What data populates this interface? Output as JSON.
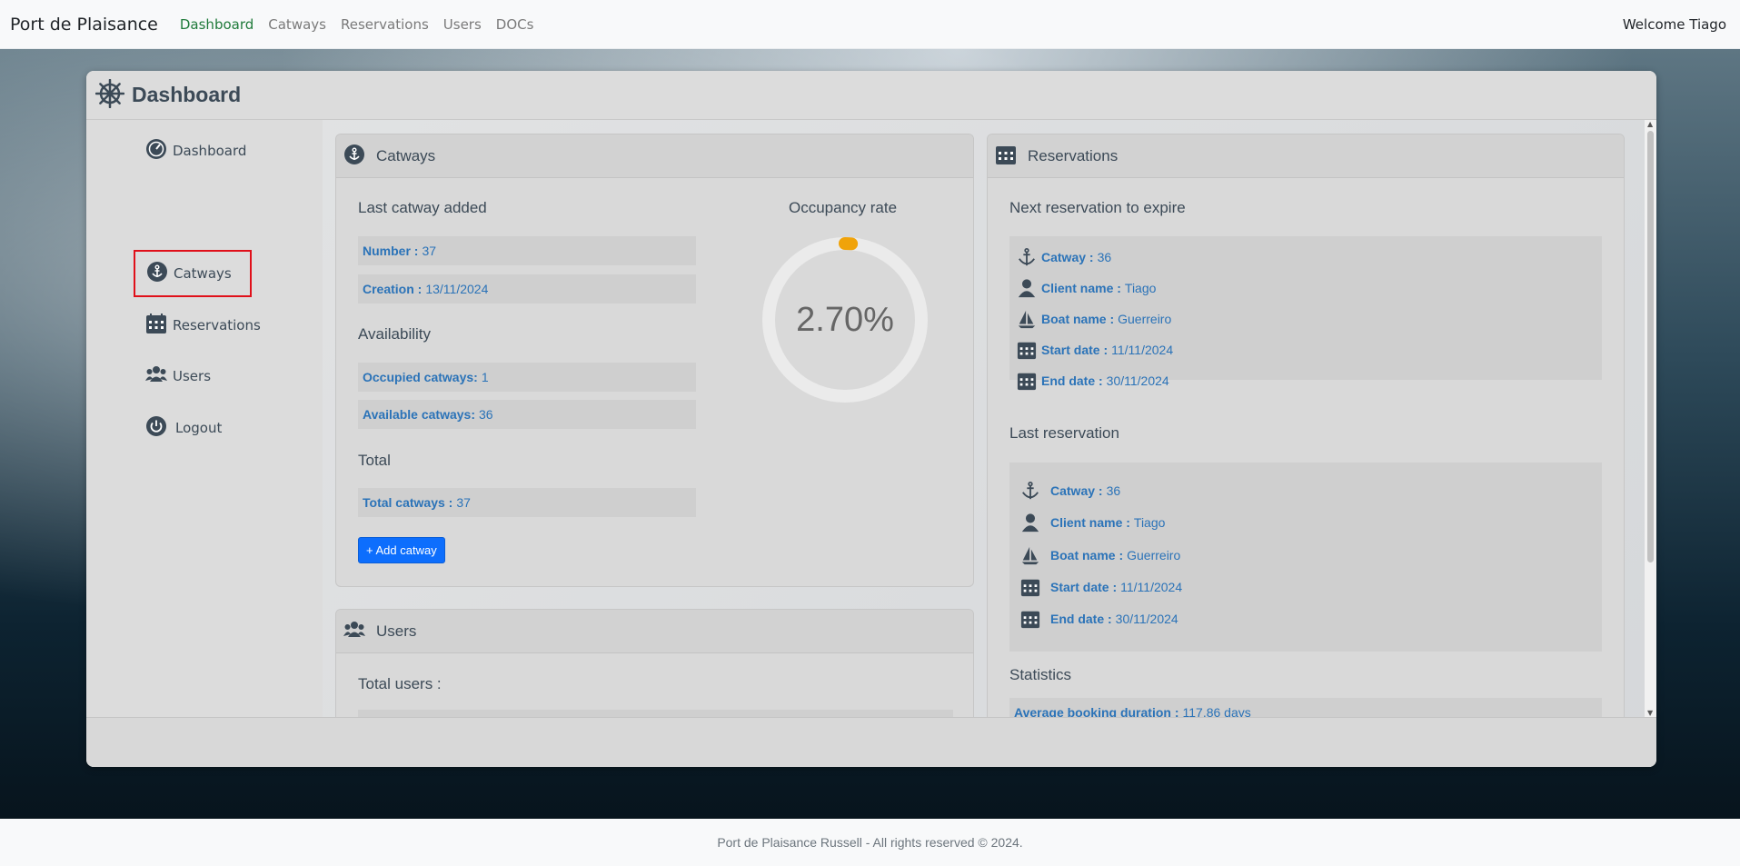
{
  "navbar": {
    "brand": "Port de Plaisance",
    "links": [
      "Dashboard",
      "Catways",
      "Reservations",
      "Users",
      "DOCs"
    ],
    "welcome": "Welcome Tiago"
  },
  "window": {
    "title": "Dashboard"
  },
  "sidebar": {
    "items": [
      {
        "label": "Dashboard",
        "icon": "dashboard-gauge-icon"
      },
      {
        "label": "Catways",
        "icon": "anchor-icon"
      },
      {
        "label": "Reservations",
        "icon": "calendar-icon"
      },
      {
        "label": "Users",
        "icon": "users-icon"
      },
      {
        "label": "Logout",
        "icon": "power-icon"
      }
    ]
  },
  "catways_card": {
    "title": "Catways",
    "last_added_heading": "Last catway added",
    "number_label": "Number :",
    "number_value": "37",
    "creation_label": "Creation :",
    "creation_value": "13/11/2024",
    "availability_heading": "Availability",
    "occupied_label": "Occupied catways:",
    "occupied_value": "1",
    "available_label": "Available catways:",
    "available_value": "36",
    "total_heading": "Total",
    "total_label": "Total catways :",
    "total_value": "37",
    "add_button": "+ Add catway",
    "occupancy_heading": "Occupancy rate",
    "occupancy_text": "2.70%",
    "occupancy_fraction": 0.027,
    "colors": {
      "gauge_fill": "#f0a30a",
      "gauge_track": "#ebebeb"
    }
  },
  "users_card": {
    "title": "Users",
    "total_users_label": "Total users :"
  },
  "reservations_card": {
    "title": "Reservations",
    "next_heading": "Next reservation to expire",
    "next": {
      "catway_label": "Catway :",
      "catway_value": "36",
      "client_label": "Client name :",
      "client_value": "Tiago",
      "boat_label": "Boat name :",
      "boat_value": "Guerreiro",
      "start_label": "Start date :",
      "start_value": "11/11/2024",
      "end_label": "End date :",
      "end_value": "30/11/2024"
    },
    "last_heading": "Last reservation",
    "last": {
      "catway_label": "Catway :",
      "catway_value": "36",
      "client_label": "Client name :",
      "client_value": "Tiago",
      "boat_label": "Boat name :",
      "boat_value": "Guerreiro",
      "start_label": "Start date :",
      "start_value": "11/11/2024",
      "end_label": "End date :",
      "end_value": "30/11/2024"
    },
    "statistics_heading": "Statistics",
    "avg_label": "Average booking duration :",
    "avg_value": "117.86 days"
  },
  "footer": {
    "text": "Port de Plaisance Russell - All rights reserved © 2024."
  },
  "colors": {
    "accent_link": "#2b73b8",
    "active_nav": "#1f7a3a",
    "primary_button": "#0d6efd",
    "highlight_border": "#e0101a"
  }
}
